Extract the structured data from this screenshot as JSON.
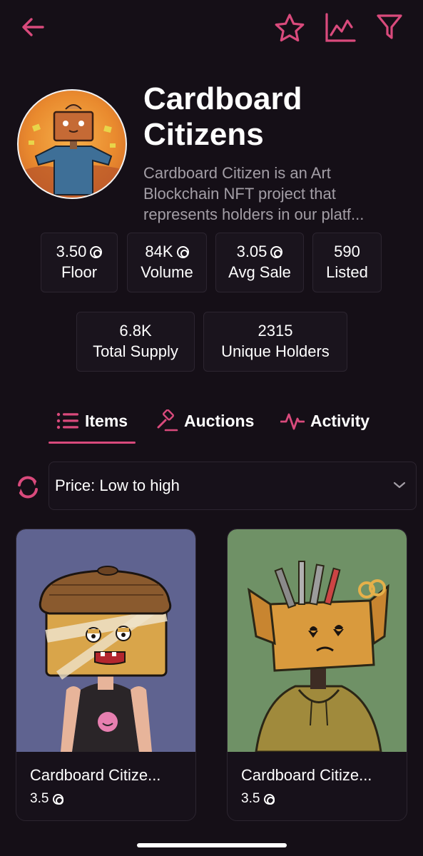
{
  "header": {
    "back_icon": "arrow-left-icon",
    "actions": [
      "star-icon",
      "chart-icon",
      "filter-icon"
    ]
  },
  "collection": {
    "name": "Cardboard Citizens",
    "description": "Cardboard Citizen is an Art Blockchain NFT project that represents holders in our platf..."
  },
  "stats": [
    {
      "value": "3.50",
      "label": "Floor",
      "currency": true
    },
    {
      "value": "84K",
      "label": "Volume",
      "currency": true
    },
    {
      "value": "3.05",
      "label": "Avg Sale",
      "currency": true
    },
    {
      "value": "590",
      "label": "Listed",
      "currency": false
    },
    {
      "value": "6.8K",
      "label": "Total Supply",
      "currency": false
    },
    {
      "value": "2315",
      "label": "Unique Holders",
      "currency": false
    }
  ],
  "tabs": [
    {
      "label": "Items",
      "icon": "list-icon",
      "active": true
    },
    {
      "label": "Auctions",
      "icon": "gavel-icon",
      "active": false
    },
    {
      "label": "Activity",
      "icon": "activity-icon",
      "active": false
    }
  ],
  "sort": {
    "selected": "Price: Low to high"
  },
  "items": [
    {
      "name": "Cardboard Citize...",
      "price": "3.5"
    },
    {
      "name": "Cardboard Citize...",
      "price": "3.5"
    }
  ],
  "colors": {
    "accent": "#d94a7c",
    "background": "#150f17",
    "muted_text": "#a39ea6",
    "card_border": "#2c2530"
  }
}
